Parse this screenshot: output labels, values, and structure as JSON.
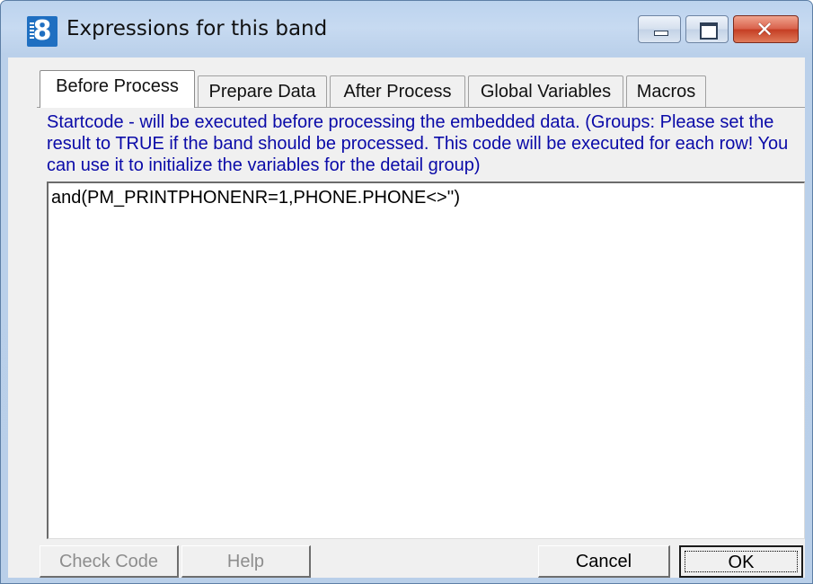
{
  "window": {
    "title": "Expressions for this band",
    "icon": "app-8-icon",
    "controls": {
      "minimize": "minimize-icon",
      "maximize": "maximize-icon",
      "close": "✕"
    }
  },
  "tabs": [
    {
      "label": "Before Process",
      "active": true
    },
    {
      "label": "Prepare Data",
      "active": false
    },
    {
      "label": "After Process",
      "active": false
    },
    {
      "label": "Global Variables",
      "active": false
    },
    {
      "label": "Macros",
      "active": false
    }
  ],
  "description": "Startcode - will be executed before processing the embedded data. (Groups: Please set the result to TRUE if the band should be processed. This code will be executed for each row! You can use it to initialize the variables for the detail group)",
  "editor": {
    "value": "and(PM_PRINTPHONENR=1,PHONE.PHONE<>'')"
  },
  "buttons": {
    "check_code": "Check Code",
    "help": "Help",
    "cancel": "Cancel",
    "ok": "OK"
  },
  "colors": {
    "description_text": "#0a0aa8",
    "title_bar": "#c7daf1",
    "close_button": "#c43c22"
  }
}
